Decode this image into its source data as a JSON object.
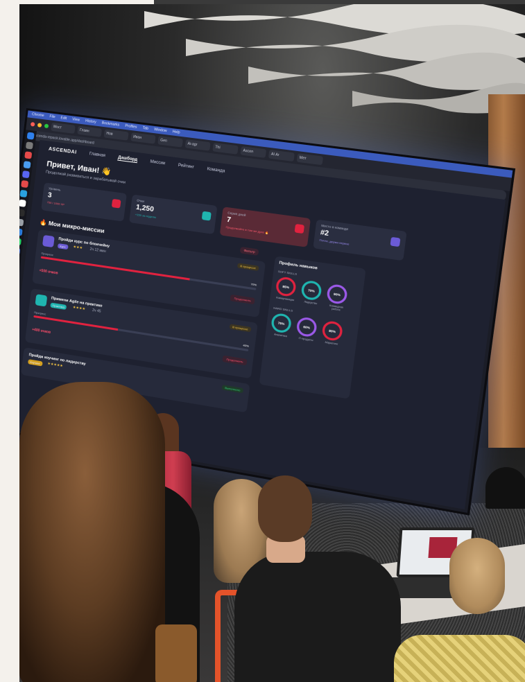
{
  "browser": {
    "menu": [
      "Chrome",
      "File",
      "Edit",
      "View",
      "History",
      "Bookmarks",
      "Profiles",
      "Tab",
      "Window",
      "Help"
    ],
    "url": "ascenda-repack.lovable.app/dashboard",
    "tabs": [
      "Мост",
      "Главн",
      "Нов",
      "Иван",
      "Gen",
      "Ai-agr",
      "Thi",
      "Ascen",
      "AI Ar",
      "Мет"
    ]
  },
  "app": {
    "logo": "ASCENDAI",
    "nav": [
      "Главная",
      "Дашборд",
      "Миссии",
      "Рейтинг",
      "Команда"
    ],
    "greeting": "Привет, Иван! 👋",
    "subtitle": "Продолжай развиваться и зарабатывай очки",
    "stats": [
      {
        "label": "Уровень",
        "value": "3",
        "sub": "750 / 1000 XP",
        "accent": "#e0223f"
      },
      {
        "label": "Очки",
        "value": "1,250",
        "sub": "+150 за неделю",
        "accent": "#1fb5b0"
      },
      {
        "label": "Серия дней",
        "value": "7",
        "sub": "Продолжайте в том же духе 🔥",
        "accent": "#e0223f"
      },
      {
        "label": "Место в команде",
        "value": "#2",
        "sub": "Почти, держи первое",
        "accent": "#6b5bd6"
      }
    ],
    "missions_title": "🔥 Мои микро-миссии",
    "filter_label": "Фильтр",
    "missions": [
      {
        "title": "Пройди курс по блокчейну",
        "tag": "Курс",
        "stars": "★★★",
        "duration": "2ч 12 мин",
        "status": "В процессе",
        "progress_label": "Прогресс",
        "progress": 70,
        "progress_text": "70%",
        "xp": "+500 очков",
        "continue": "Продолжить"
      },
      {
        "title": "Примени Agile на практике",
        "tag": "Практика",
        "stars": "★★★★",
        "duration": "2ч 45",
        "status": "В процессе",
        "progress_label": "Прогресс",
        "progress": 40,
        "progress_text": "40%",
        "xp": "+400 очков",
        "continue": "Продолжить"
      },
      {
        "title": "Пройди коучинг по лидерству",
        "tag": "Коучинг",
        "stars": "★★★★★",
        "status": "Выполнено"
      }
    ],
    "skills": {
      "title": "Профиль навыков",
      "soft_title": "SOFT SKILLS",
      "hard_title": "HARD SKILLS",
      "soft": [
        {
          "name": "Коммуникация",
          "value": "85%",
          "color": "#e0223f"
        },
        {
          "name": "Лидерство",
          "value": "70%",
          "color": "#1fb5b0"
        },
        {
          "name": "Командная работа",
          "value": "90%",
          "color": "#9b59e8"
        }
      ],
      "hard": [
        {
          "name": "Аналитика",
          "value": "75%",
          "color": "#1fb5b0"
        },
        {
          "name": "IT-продукты",
          "value": "60%",
          "color": "#9b59e8"
        },
        {
          "name": "Маркетинг",
          "value": "80%",
          "color": "#e0223f"
        }
      ]
    }
  }
}
